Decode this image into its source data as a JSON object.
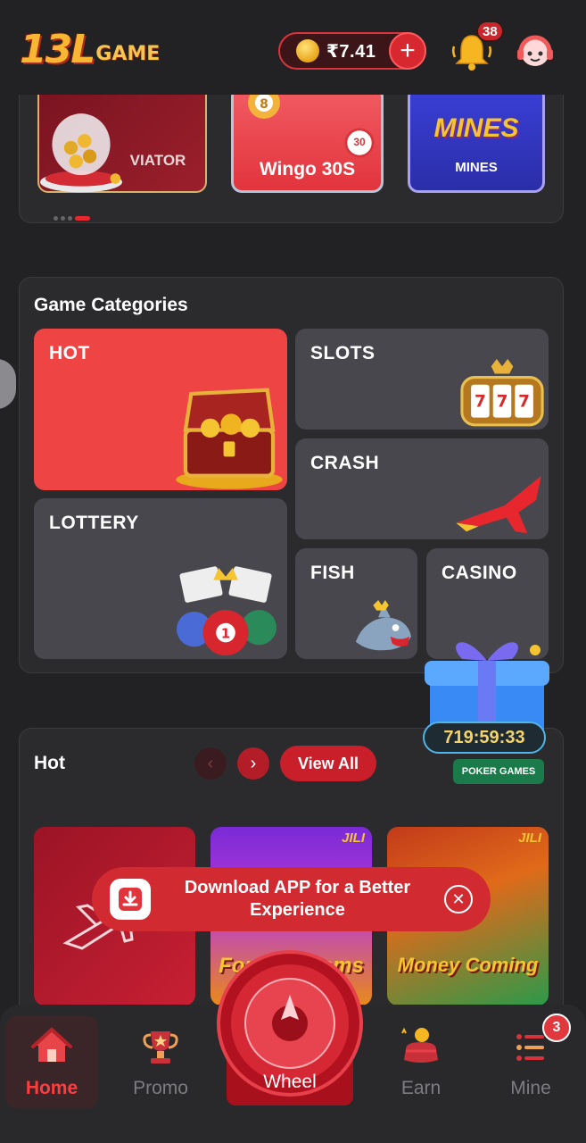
{
  "header": {
    "logo_main": "13L",
    "logo_sub": "GAME",
    "balance": "₹7.41",
    "notification_count": "38"
  },
  "carousel": {
    "tiles": [
      {
        "label": "VIATOR"
      },
      {
        "label": "Wingo 30S",
        "badge": "30"
      },
      {
        "label": "MINES",
        "title": "mines"
      }
    ]
  },
  "categories": {
    "title": "Game Categories",
    "items": [
      {
        "label": "HOT"
      },
      {
        "label": "SLOTS"
      },
      {
        "label": "CRASH"
      },
      {
        "label": "LOTTERY"
      },
      {
        "label": "FISH"
      },
      {
        "label": "CASINO"
      }
    ]
  },
  "hot": {
    "title": "Hot",
    "view_all": "View All",
    "games": [
      {
        "label": ""
      },
      {
        "label": "Fortune Gems",
        "brand": "JILI"
      },
      {
        "label": "Money Coming",
        "brand": "JILI"
      }
    ]
  },
  "promo_widget": {
    "timer": "719:59:33",
    "tag": "POKER GAMES"
  },
  "download_banner": {
    "text_line1": "Download APP for a Better",
    "text_line2": "Experience"
  },
  "bottom_nav": {
    "items": [
      {
        "label": "Home"
      },
      {
        "label": "Promo"
      },
      {
        "label": "Wheel"
      },
      {
        "label": "Earn"
      },
      {
        "label": "Mine"
      }
    ],
    "mine_badge": "3"
  },
  "colors": {
    "background": "#222225",
    "accent": "#d8282f",
    "hot_category": "#ee4444",
    "panel": "#2b2b2e"
  }
}
